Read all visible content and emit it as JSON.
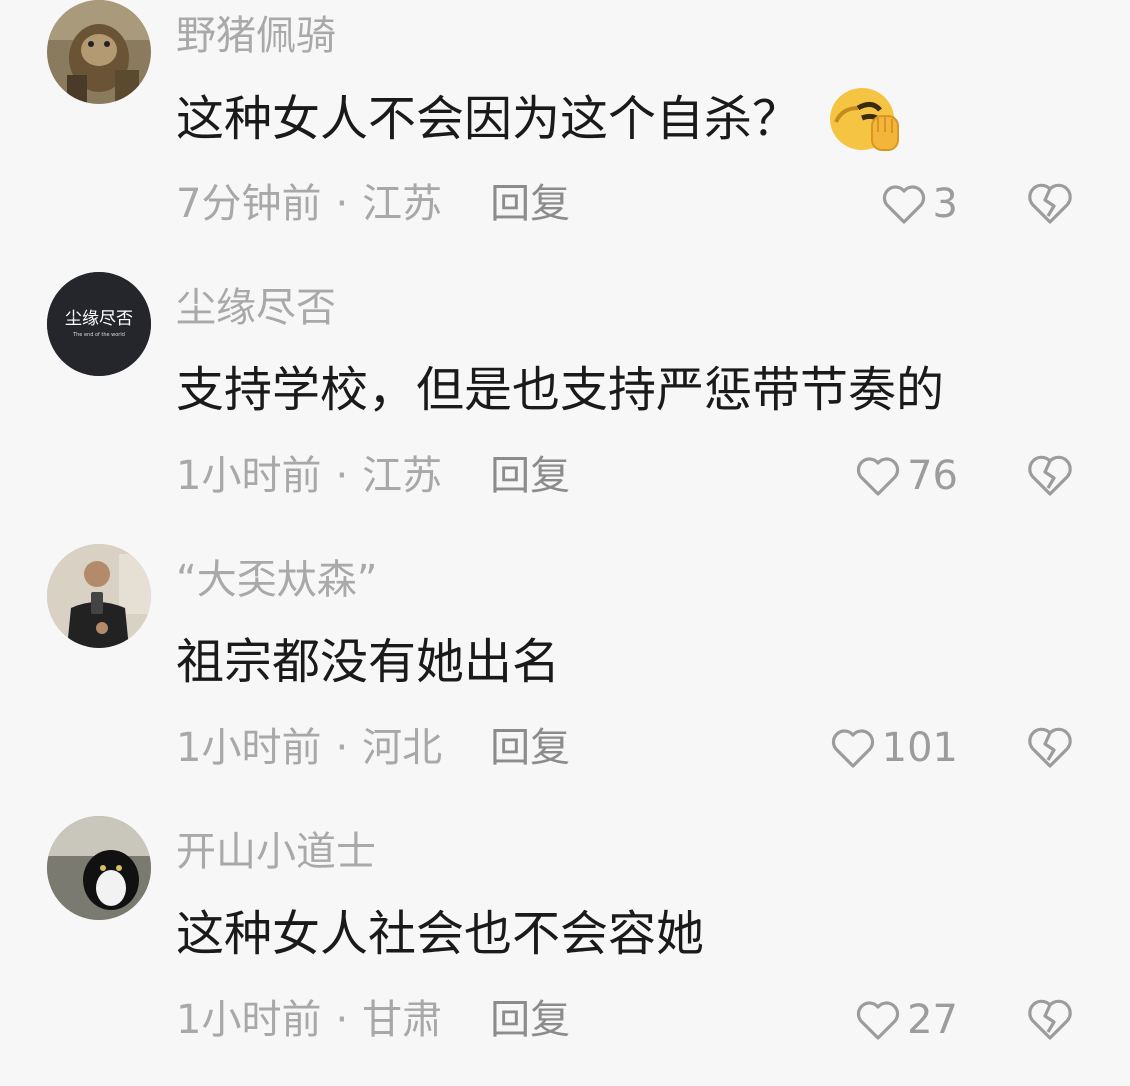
{
  "comments": [
    {
      "username": "野猪佩骑",
      "text": "这种女人不会因为这个自杀？",
      "emoji": "facepalm-emoji",
      "time": "7分钟前",
      "location": "江苏",
      "reply_label": "回复",
      "likes": "3"
    },
    {
      "username": "尘缘尽否",
      "text": "支持学校，但是也支持严惩带节奏的",
      "avatar_text": "尘缘尽否",
      "avatar_subtext": "The end of the world",
      "time": "1小时前",
      "location": "江苏",
      "reply_label": "回复",
      "likes": "76"
    },
    {
      "username": "“大奀夶森”",
      "text": "祖宗都没有她出名",
      "time": "1小时前",
      "location": "河北",
      "reply_label": "回复",
      "likes": "101"
    },
    {
      "username": "开山小道士",
      "text": "这种女人社会也不会容她",
      "time": "1小时前",
      "location": "甘肃",
      "reply_label": "回复",
      "likes": "27"
    }
  ],
  "colors": {
    "background": "#f7f7f7",
    "text": "#1a1a1a",
    "muted": "#a8a8a8"
  }
}
